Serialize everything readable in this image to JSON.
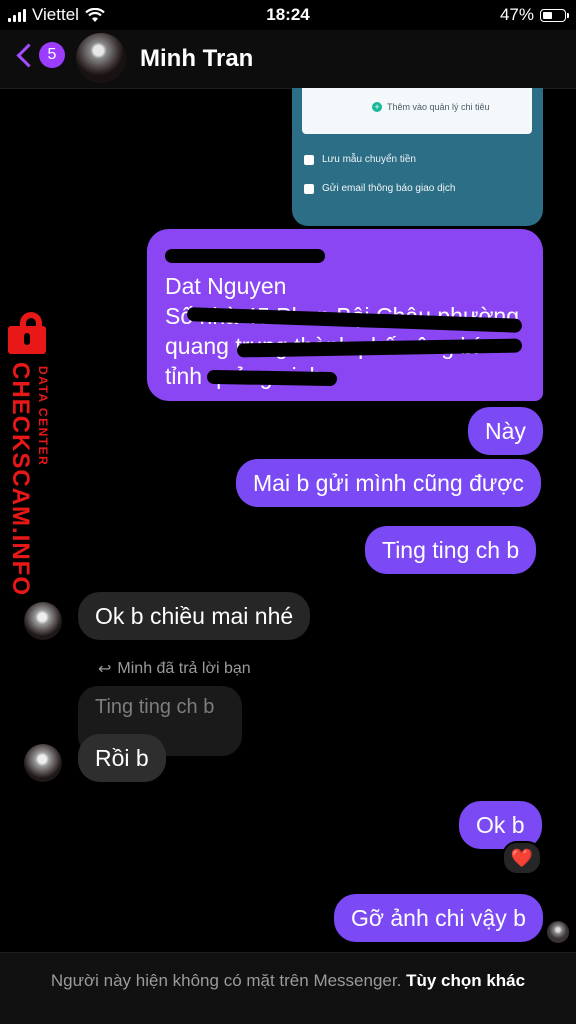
{
  "status_bar": {
    "carrier": "Viettel",
    "time": "18:24",
    "battery": "47%",
    "battery_level": 0.47
  },
  "header": {
    "back_count": "5",
    "contact_name": "Minh Tran"
  },
  "shared_image": {
    "add_text": "Thêm vào quản lý chi tiêu",
    "option_1": "Lưu mẫu chuyển tiền",
    "option_2": "Gửi email thông báo giao dịch"
  },
  "messages": {
    "address_name": "Dat Nguyen",
    "address_line_1": "Số nhà 45 Phan Bội Châu phường",
    "address_line_2": "quang trung thành phố uông bí",
    "address_line_3": "tỉnh quảng ninh",
    "out_1": "Này",
    "out_2": "Mai b gửi mình cũng được",
    "out_3": "Ting ting ch b",
    "in_1": "Ok b chiều mai nhé",
    "reply_note": "Minh đã trả lời bạn",
    "quoted": "Ting ting ch b",
    "in_2": "Rồi b",
    "out_4": "Ok b",
    "reaction": "❤️",
    "out_5": "Gỡ ảnh chi vậy b"
  },
  "footer": {
    "text": "Người này hiện không có mặt trên Messenger.",
    "link": "Tùy chọn khác"
  },
  "watermark": {
    "brand": "CHECKSCAM.INFO",
    "sub": "DATA CENTER"
  },
  "colors": {
    "outgoing": "#7b4af5",
    "incoming": "#262626",
    "accent": "#a34dff",
    "watermark": "#e81818"
  }
}
